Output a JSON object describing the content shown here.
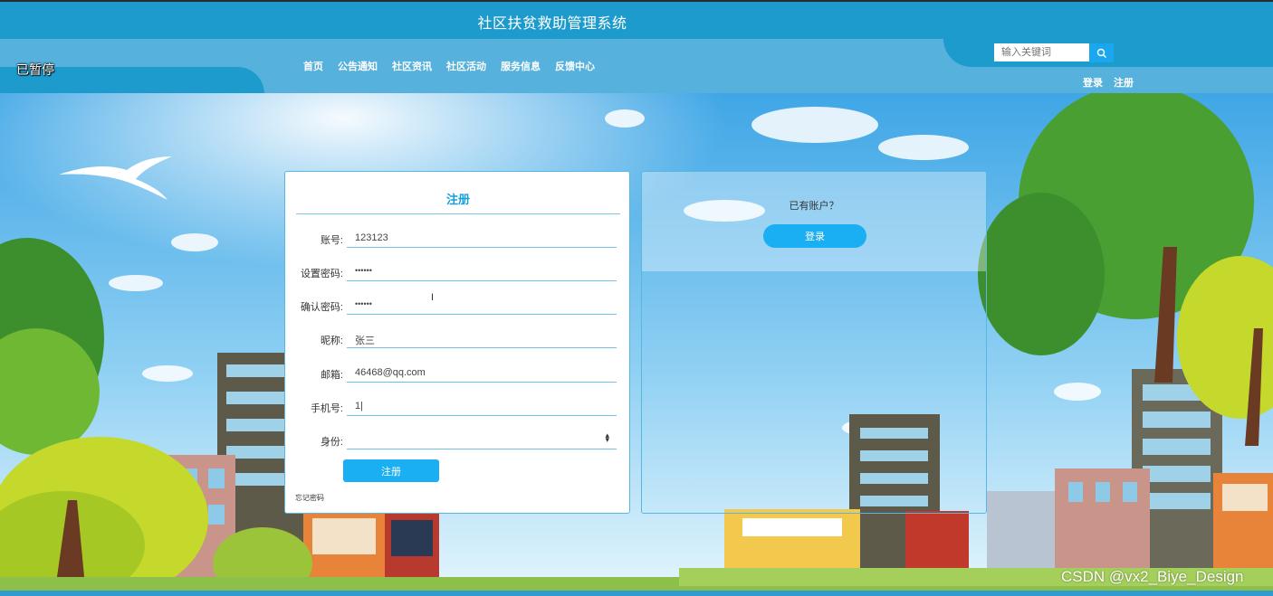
{
  "header": {
    "title": "社区扶贫救助管理系统"
  },
  "overlay": {
    "status": "已暂停"
  },
  "nav": {
    "items": [
      "首页",
      "公告通知",
      "社区资讯",
      "社区活动",
      "服务信息",
      "反馈中心"
    ]
  },
  "search": {
    "placeholder": "输入关键词",
    "icon": "search-icon"
  },
  "auth": {
    "login": "登录",
    "register": "注册"
  },
  "register_form": {
    "title": "注册",
    "fields": [
      {
        "label": "账号:",
        "value": "123123"
      },
      {
        "label": "设置密码:",
        "value": "••••••"
      },
      {
        "label": "确认密码:",
        "value": "••••••"
      },
      {
        "label": "昵称:",
        "value": "张三"
      },
      {
        "label": "邮箱:",
        "value": "46468@qq.com"
      },
      {
        "label": "手机号:",
        "value": "1|"
      },
      {
        "label": "身份:",
        "value": ""
      }
    ],
    "submit": "注册",
    "forgot": "忘记密码"
  },
  "login_panel": {
    "prompt": "已有账户？",
    "button": "登录"
  },
  "watermark": "CSDN @vx2_Biye_Design",
  "colors": {
    "primary": "#1e9bcd",
    "nav": "#56b1dc",
    "button": "#1aaef2",
    "accent_text": "#18a0dd"
  }
}
